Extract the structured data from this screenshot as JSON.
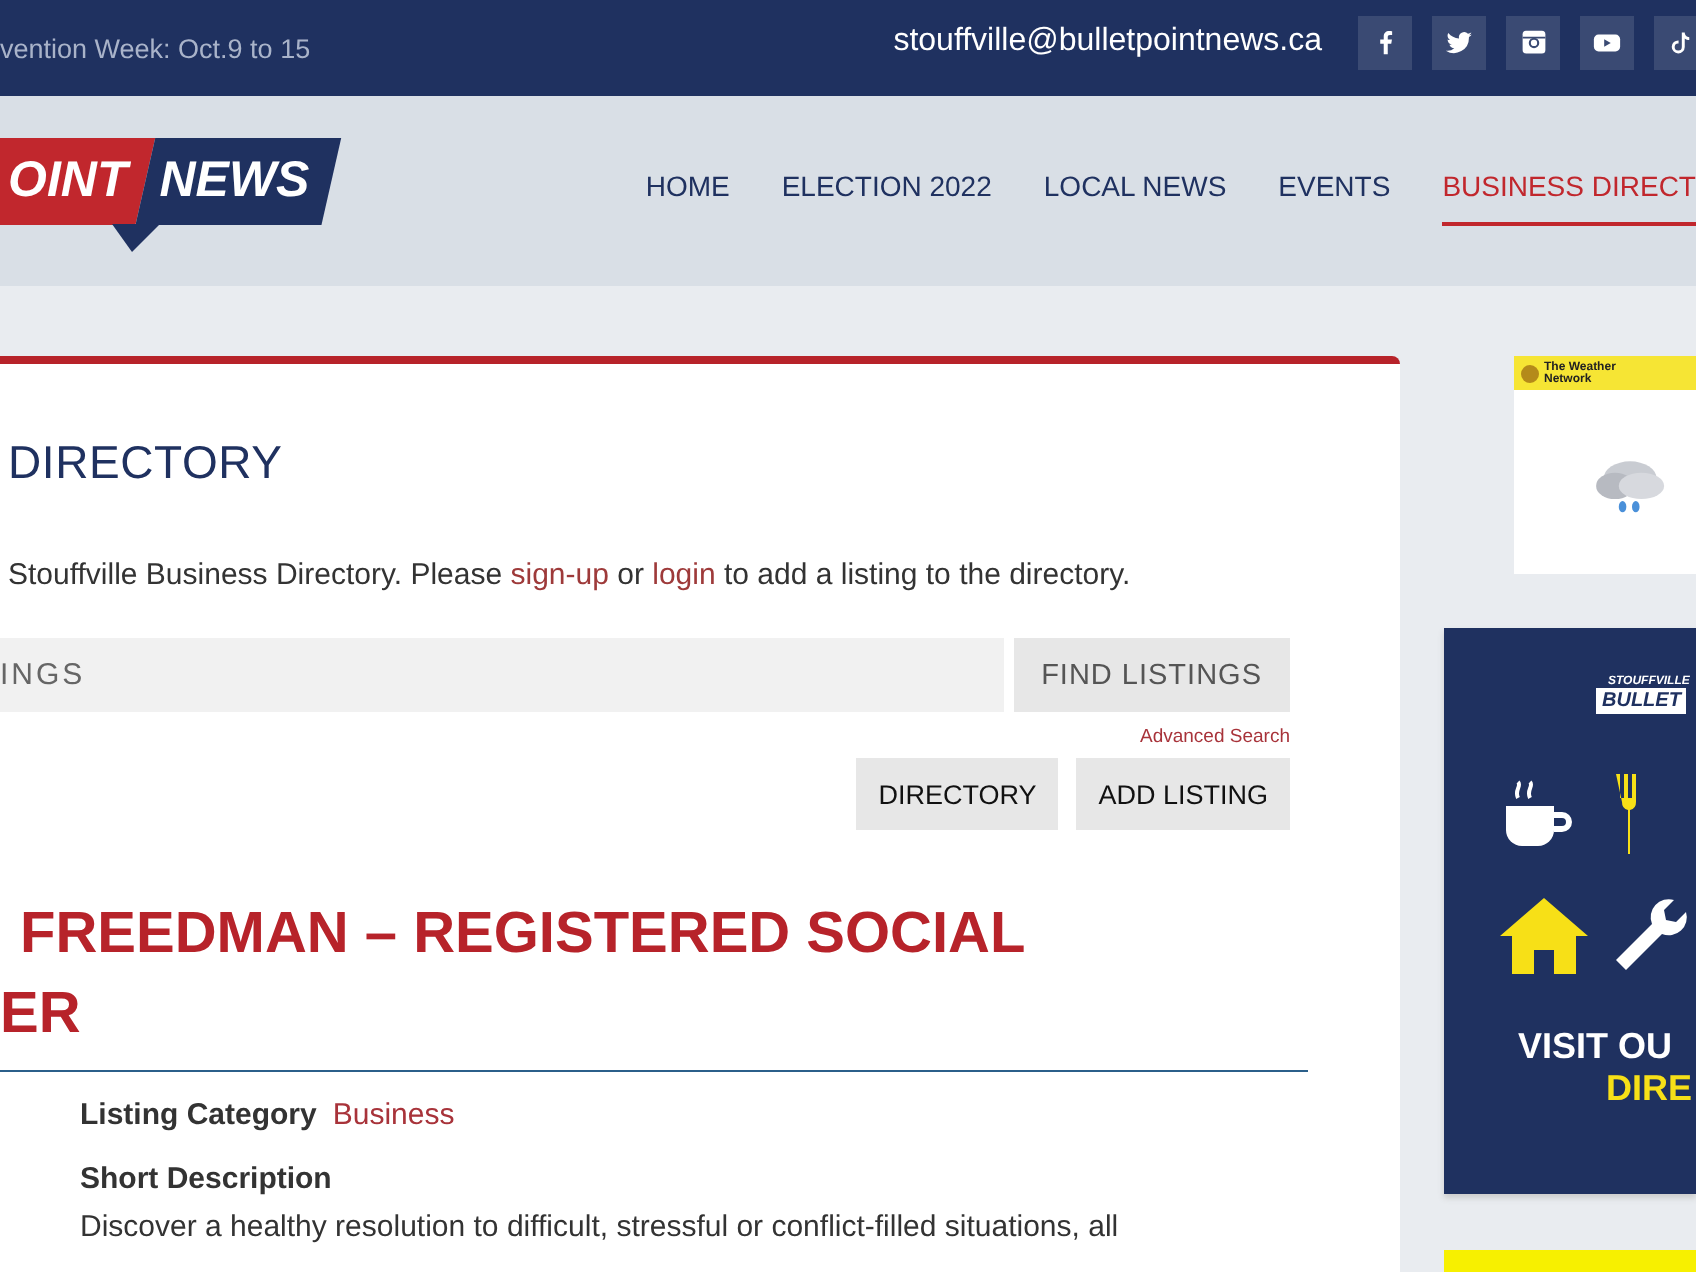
{
  "top_bar": {
    "announcement": "vention Week: Oct.9 to 15",
    "email": "stouffville@bulletpointnews.ca",
    "social": [
      {
        "kind": "facebook"
      },
      {
        "kind": "twitter"
      },
      {
        "kind": "instagram"
      },
      {
        "kind": "youtube"
      },
      {
        "kind": "tiktok"
      }
    ]
  },
  "header": {
    "logo": {
      "part_1": "OINT",
      "part_2": "NEWS"
    },
    "nav": [
      {
        "label": "HOME",
        "selected": false
      },
      {
        "label": "ELECTION 2022",
        "selected": false
      },
      {
        "label": "LOCAL NEWS",
        "selected": false
      },
      {
        "label": "EVENTS",
        "selected": false
      },
      {
        "label": "BUSINESS DIRECT",
        "selected": true
      }
    ]
  },
  "main": {
    "title": "DIRECTORY",
    "intro": {
      "before": "Stouffville Business Directory. Please ",
      "link_1": "sign-up",
      "middle": " or ",
      "link_2": "login",
      "after": " to add a listing to the directory."
    },
    "search": {
      "placeholder": "INGS",
      "button": "FIND LISTINGS",
      "advanced": "Advanced Search"
    },
    "buttons": [
      "DIRECTORY",
      "ADD LISTING"
    ],
    "listing": {
      "title_lines": [
        "FREEDMAN – REGISTERED SOCIAL",
        "ER"
      ],
      "category_label": "Listing Category",
      "category": "Business",
      "short_description_label": "Short Description",
      "description": "Discover a healthy resolution to difficult, stressful or conflict-filled situations, all"
    }
  },
  "sidebar": {
    "weather": {
      "brand": "The Weather Network"
    },
    "ad": {
      "kicker": "STOUFFVILLE",
      "brand": "BULLET",
      "line_1": "VISIT OU",
      "line_2": "DIRE"
    }
  }
}
